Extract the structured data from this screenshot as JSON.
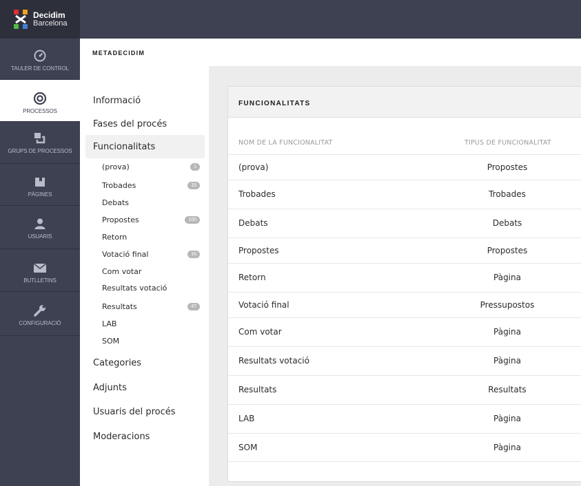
{
  "brand": {
    "line1": "Decidim",
    "line2": "Barcelona",
    "logo_icon": "decidim-logo-icon"
  },
  "rail": [
    {
      "label": "TAULER DE CONTROL",
      "icon": "dashboard-gauge-icon"
    },
    {
      "label": "PROCESSOS",
      "icon": "target-circle-icon",
      "active": true
    },
    {
      "label": "GRUPS DE PROCESSOS",
      "icon": "stacked-squares-icon"
    },
    {
      "label": "PÀGINES",
      "icon": "book-icon"
    },
    {
      "label": "USUARIS",
      "icon": "user-icon"
    },
    {
      "label": "BUTLLETINS",
      "icon": "envelope-icon"
    },
    {
      "label": "CONFIGURACIÓ",
      "icon": "wrench-icon"
    }
  ],
  "space_title": "METADECIDIM",
  "nav": {
    "informacio": "Informació",
    "fases": "Fases del procés",
    "funcionalitats": "Funcionalitats",
    "categories": "Categories",
    "adjunts": "Adjunts",
    "usuaris": "Usuaris del procés",
    "moderacions": "Moderacions"
  },
  "features": [
    {
      "name": "(prova)",
      "badge": "1"
    },
    {
      "name": "Trobades",
      "badge": "15"
    },
    {
      "name": "Debats",
      "badge": ""
    },
    {
      "name": "Propostes",
      "badge": "100"
    },
    {
      "name": "Retorn",
      "badge": ""
    },
    {
      "name": "Votació final",
      "badge": "16"
    },
    {
      "name": "Com votar",
      "badge": ""
    },
    {
      "name": "Resultats votació",
      "badge": ""
    },
    {
      "name": "Resultats",
      "badge": "47"
    },
    {
      "name": "LAB",
      "badge": ""
    },
    {
      "name": "SOM",
      "badge": ""
    }
  ],
  "card": {
    "title": "FUNCIONALITATS",
    "col_name": "NOM DE LA FUNCIONALITAT",
    "col_type": "TIPUS DE FUNCIONALITAT",
    "rows": [
      {
        "name": "(prova)",
        "type": "Propostes"
      },
      {
        "name": "Trobades",
        "type": "Trobades"
      },
      {
        "name": "Debats",
        "type": "Debats"
      },
      {
        "name": "Propostes",
        "type": "Propostes"
      },
      {
        "name": "Retorn",
        "type": "Pàgina"
      },
      {
        "name": "Votació final",
        "type": "Pressupostos"
      },
      {
        "name": "Com votar",
        "type": "Pàgina"
      },
      {
        "name": "Resultats votació",
        "type": "Pàgina"
      },
      {
        "name": "Resultats",
        "type": "Resultats"
      },
      {
        "name": "LAB",
        "type": "Pàgina"
      },
      {
        "name": "SOM",
        "type": "Pàgina"
      }
    ]
  },
  "colors": {
    "rail": "#3d4151",
    "brand_bg": "#2d2f3b",
    "accent_red": "#e02d2d"
  }
}
